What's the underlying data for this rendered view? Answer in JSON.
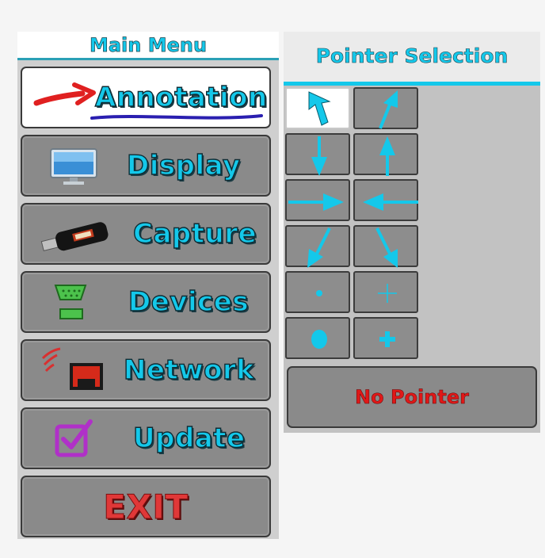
{
  "main_menu": {
    "title": "Main Menu",
    "items": [
      {
        "label": "Annotation",
        "icon": "red-arrow-icon",
        "active": true
      },
      {
        "label": "Display",
        "icon": "monitor-icon",
        "active": false
      },
      {
        "label": "Capture",
        "icon": "usb-stick-icon",
        "active": false
      },
      {
        "label": "Devices",
        "icon": "serial-port-icon",
        "active": false
      },
      {
        "label": "Network",
        "icon": "ethernet-port-icon",
        "active": false
      },
      {
        "label": "Update",
        "icon": "checkbox-icon",
        "active": false
      },
      {
        "label": "EXIT",
        "icon": "",
        "active": false
      }
    ]
  },
  "pointer_panel": {
    "title": "Pointer Selection",
    "no_pointer_label": "No Pointer",
    "pointers": [
      {
        "icon": "arrow-up-left-icon",
        "selected": true
      },
      {
        "icon": "arrow-up-right-icon",
        "selected": false
      },
      {
        "icon": "arrow-down-icon",
        "selected": false
      },
      {
        "icon": "arrow-up-icon",
        "selected": false
      },
      {
        "icon": "arrow-right-icon",
        "selected": false
      },
      {
        "icon": "arrow-left-icon",
        "selected": false
      },
      {
        "icon": "arrow-down-left-icon",
        "selected": false
      },
      {
        "icon": "arrow-down-right-icon",
        "selected": false
      },
      {
        "icon": "small-dot-icon",
        "selected": false
      },
      {
        "icon": "thin-cross-icon",
        "selected": false
      },
      {
        "icon": "large-dot-icon",
        "selected": false
      },
      {
        "icon": "bold-cross-icon",
        "selected": false
      }
    ]
  },
  "colors": {
    "accent": "#14c8ea",
    "exit": "#e03838",
    "no_pointer": "#e01818",
    "button": "#8a8a8a"
  }
}
